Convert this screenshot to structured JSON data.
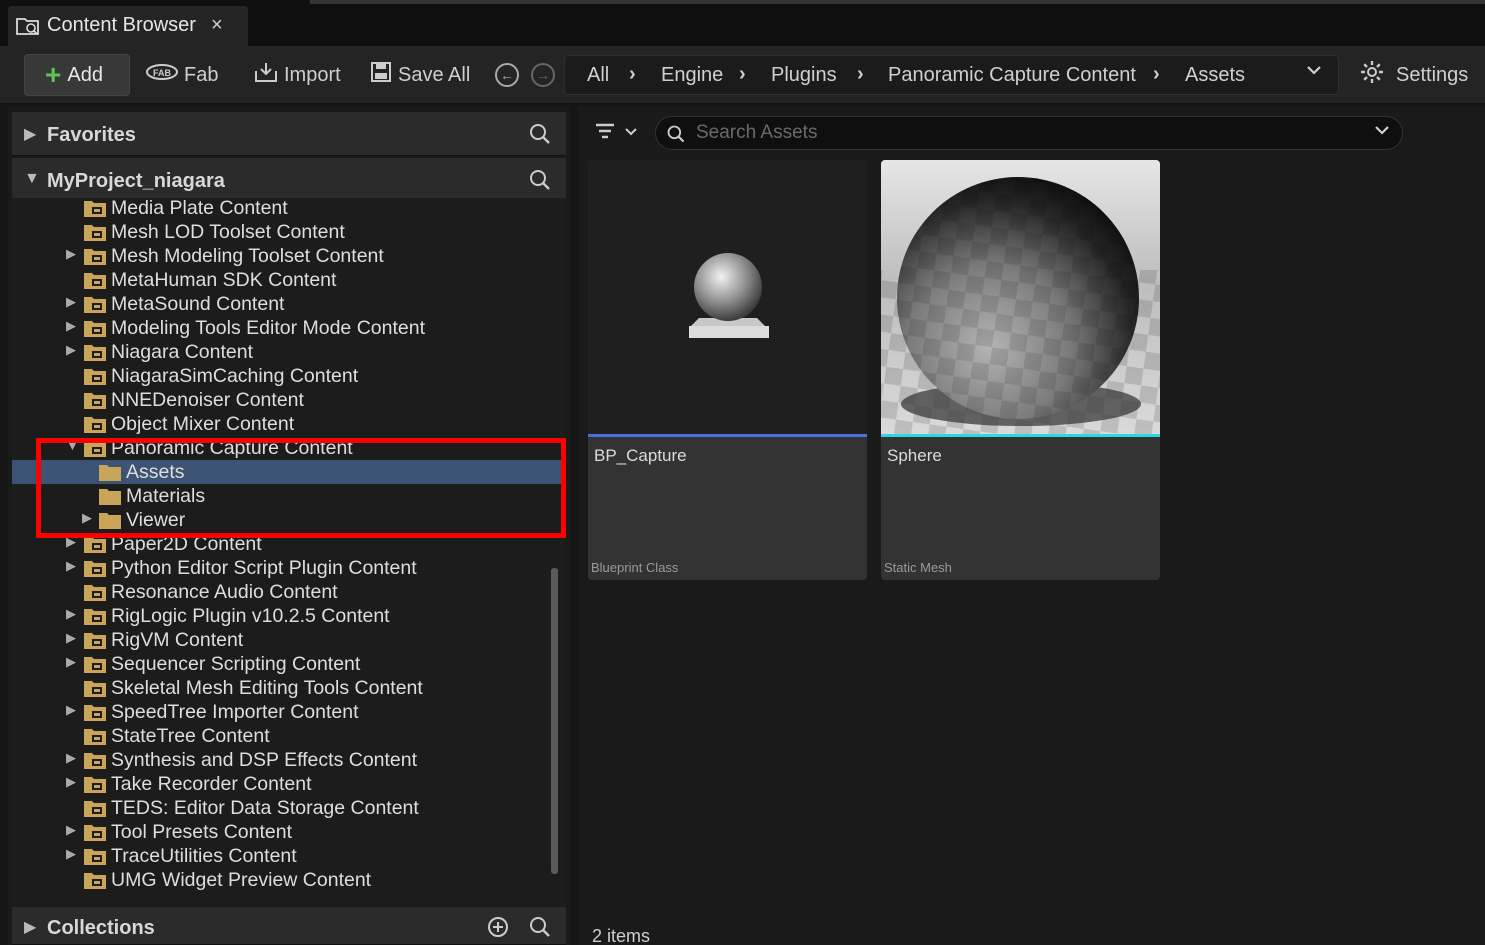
{
  "window": {
    "tab_title": "Content Browser",
    "close_glyph": "×"
  },
  "toolbar": {
    "add_label": "Add",
    "fab_label": "Fab",
    "import_label": "Import",
    "saveall_label": "Save All",
    "settings_label": "Settings"
  },
  "breadcrumb": {
    "items": [
      "All",
      "Engine",
      "Plugins",
      "Panoramic Capture Content",
      "Assets"
    ]
  },
  "sidebar": {
    "favorites_label": "Favorites",
    "project_label": "MyProject_niagara",
    "collections_label": "Collections",
    "tree": [
      {
        "label": "Media Plate Content",
        "expander": ""
      },
      {
        "label": "Mesh LOD Toolset Content",
        "expander": ""
      },
      {
        "label": "Mesh Modeling Toolset Content",
        "expander": "▶"
      },
      {
        "label": "MetaHuman SDK Content",
        "expander": ""
      },
      {
        "label": "MetaSound Content",
        "expander": "▶"
      },
      {
        "label": "Modeling Tools Editor Mode Content",
        "expander": "▶"
      },
      {
        "label": "Niagara Content",
        "expander": "▶"
      },
      {
        "label": "NiagaraSimCaching Content",
        "expander": ""
      },
      {
        "label": "NNEDenoiser Content",
        "expander": ""
      },
      {
        "label": "Object Mixer Content",
        "expander": ""
      },
      {
        "label": "Panoramic Capture Content",
        "expander": "▼"
      },
      {
        "label": "Assets",
        "expander": ""
      },
      {
        "label": "Materials",
        "expander": ""
      },
      {
        "label": "Viewer",
        "expander": "▶"
      },
      {
        "label": "Paper2D Content",
        "expander": "▶"
      },
      {
        "label": "Python Editor Script Plugin Content",
        "expander": "▶"
      },
      {
        "label": "Resonance Audio Content",
        "expander": ""
      },
      {
        "label": "RigLogic Plugin v10.2.5 Content",
        "expander": "▶"
      },
      {
        "label": "RigVM Content",
        "expander": "▶"
      },
      {
        "label": "Sequencer Scripting Content",
        "expander": "▶"
      },
      {
        "label": "Skeletal Mesh Editing Tools Content",
        "expander": ""
      },
      {
        "label": "SpeedTree Importer Content",
        "expander": "▶"
      },
      {
        "label": "StateTree Content",
        "expander": ""
      },
      {
        "label": "Synthesis and DSP Effects Content",
        "expander": "▶"
      },
      {
        "label": "Take Recorder Content",
        "expander": "▶"
      },
      {
        "label": "TEDS: Editor Data Storage Content",
        "expander": ""
      },
      {
        "label": "Tool Presets Content",
        "expander": "▶"
      },
      {
        "label": "TraceUtilities Content",
        "expander": "▶"
      },
      {
        "label": "UMG Widget Preview Content",
        "expander": ""
      }
    ]
  },
  "search": {
    "placeholder": "Search Assets"
  },
  "assets": [
    {
      "name": "BP_Capture",
      "type": "Blueprint Class",
      "accent": "#4a6fd8"
    },
    {
      "name": "Sphere",
      "type": "Static Mesh",
      "accent": "#2fd6e6"
    }
  ],
  "status": {
    "item_count": "2 items"
  },
  "colors": {
    "highlight": "#ff0000",
    "selection": "#3d5373",
    "folder": "#c9a55a"
  }
}
